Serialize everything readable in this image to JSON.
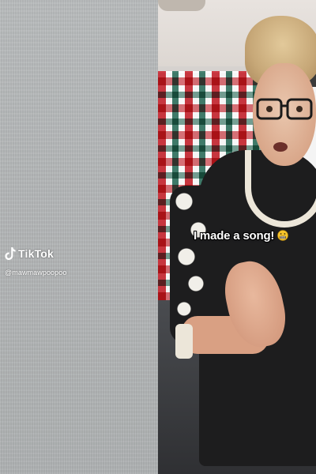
{
  "watermark": {
    "brand": "TikTok",
    "handle": "@mawmawpoopoo",
    "icon": "tiktok-logo-icon"
  },
  "video": {
    "caption": "I made a song!",
    "caption_emoji": "😬",
    "caption_emoji_name": "grimacing-face-icon"
  },
  "colors": {
    "wall": "#b3b6b7",
    "caption_text": "#ffffff",
    "caption_outline": "#000000",
    "plaid_red": "#c81e28",
    "plaid_green": "#286e5a"
  }
}
